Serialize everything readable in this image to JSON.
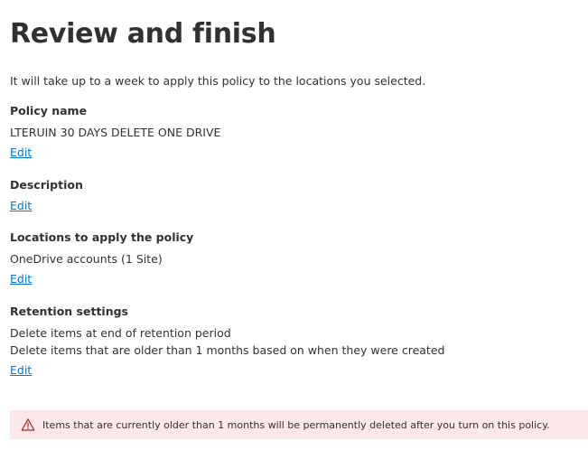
{
  "page": {
    "title": "Review and finish",
    "intro": "It will take up to a week to apply this policy to the locations you selected."
  },
  "policy_name": {
    "label": "Policy name",
    "value": "LTERUIN 30 DAYS DELETE ONE DRIVE",
    "edit_label": "Edit"
  },
  "description": {
    "label": "Description",
    "edit_label": "Edit"
  },
  "locations": {
    "label": "Locations to apply the policy",
    "value": "OneDrive accounts (1 Site)",
    "edit_label": "Edit"
  },
  "retention": {
    "label": "Retention settings",
    "lines": [
      "Delete items at end of retention period",
      "Delete items that are older than 1 months based on when they were created"
    ],
    "edit_label": "Edit"
  },
  "warning": {
    "icon": "warning-icon",
    "text": "Items that are currently older than 1 months will be permanently deleted after you turn on this policy.",
    "background_color": "#fde7e9",
    "icon_color": "#a4262c"
  },
  "colors": {
    "link": "#0078d4",
    "text": "#323130"
  }
}
